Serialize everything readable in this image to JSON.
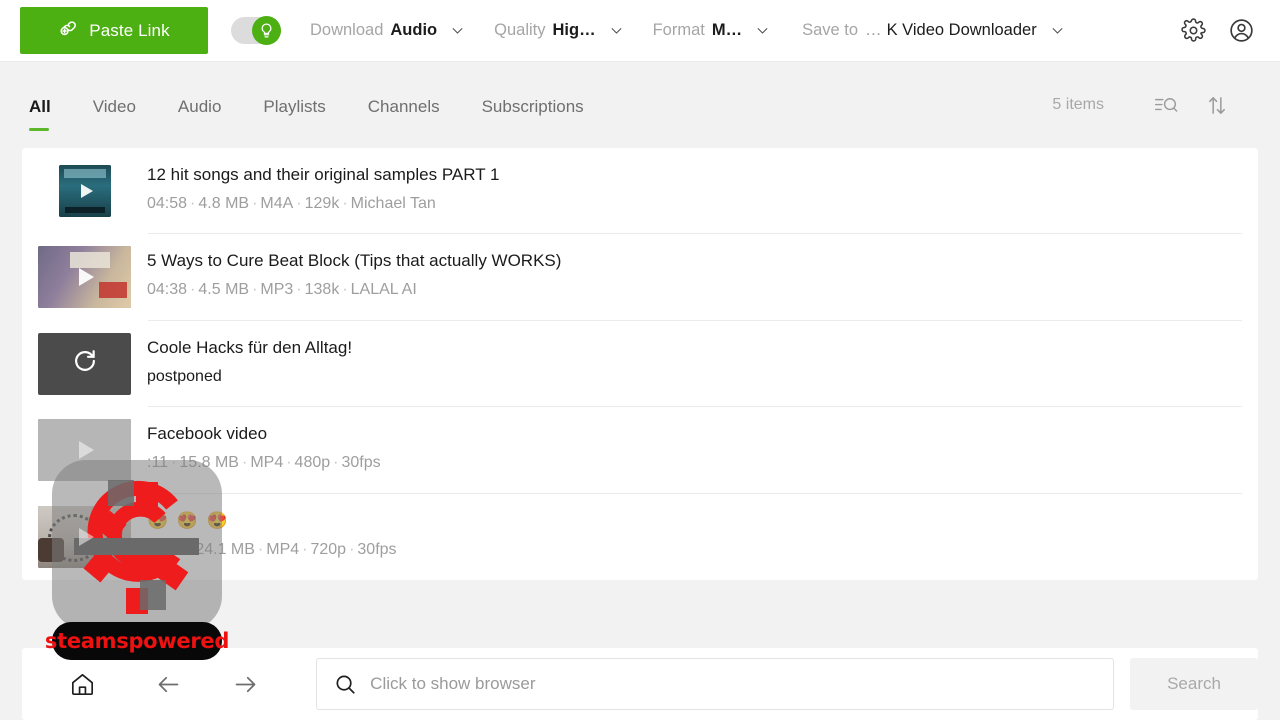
{
  "toolbar": {
    "paste_link_label": "Paste Link",
    "paste_link_icon": "link-plus-icon",
    "smart_mode_toggle": {
      "icon": "lightbulb-icon",
      "state": "on"
    },
    "download": {
      "label": "Download",
      "value": "Audio",
      "caret": "chevron-down-icon"
    },
    "quality": {
      "label": "Quality",
      "value": "Hig…",
      "caret": "chevron-down-icon"
    },
    "format": {
      "label": "Format",
      "value": "M…",
      "caret": "chevron-down-icon"
    },
    "save_to": {
      "label": "Save to",
      "ellipsis": "…",
      "value": "K Video Downloader",
      "caret": "chevron-down-icon"
    },
    "settings_icon": "gear-icon",
    "account_icon": "user-circle-icon",
    "accent_color": "#4caf12"
  },
  "tabs": {
    "items": [
      {
        "label": "All",
        "active": true
      },
      {
        "label": "Video",
        "active": false
      },
      {
        "label": "Audio",
        "active": false
      },
      {
        "label": "Playlists",
        "active": false
      },
      {
        "label": "Channels",
        "active": false
      },
      {
        "label": "Subscriptions",
        "active": false
      }
    ],
    "items_count": "5 items",
    "filter_icon": "filter-search-icon",
    "sort_icon": "sort-arrows-icon",
    "active_underline_color": "#5cb82a"
  },
  "list": {
    "rows": [
      {
        "title": "12 hit songs and their original samples PART 1",
        "meta": [
          "04:58",
          "4.8 MB",
          "M4A",
          "129k",
          "Michael Tan"
        ],
        "thumb_kind": "square-art1",
        "thumb_icon": "play-icon"
      },
      {
        "title": "5 Ways to Cure Beat Block (Tips that actually WORKS)",
        "meta": [
          "04:38",
          "4.5 MB",
          "MP3",
          "138k",
          "LALAL AI"
        ],
        "thumb_kind": "wide-art2",
        "thumb_icon": "play-icon"
      },
      {
        "title": "Coole Hacks für den Alltag!",
        "status": "postponed",
        "thumb_kind": "retry",
        "thumb_icon": "refresh-retry-icon"
      },
      {
        "title": "Facebook video",
        "meta": [
          ":11",
          "15.8 MB",
          "MP4",
          "480p",
          "30fps"
        ],
        "thumb_kind": "wide-art4",
        "thumb_icon": "play-icon"
      },
      {
        "title": "😍 😍 😍",
        "meta": [
          "0… 4",
          "24.1 MB",
          "MP4",
          "720p",
          "30fps"
        ],
        "thumb_kind": "wide-art5",
        "thumb_icon": "play-icon"
      }
    ]
  },
  "bottom": {
    "home_icon": "home-icon",
    "back_icon": "arrow-left-icon",
    "forward_icon": "arrow-right-icon",
    "search_icon": "search-icon",
    "search_placeholder": "Click to show browser",
    "search_value": "",
    "search_button_label": "Search"
  },
  "overlay": {
    "badge_label": "steamspowered",
    "badge_text_color": "#ee1111",
    "badge_bg_color": "#080808",
    "gear_color": "#ee1c1c"
  }
}
